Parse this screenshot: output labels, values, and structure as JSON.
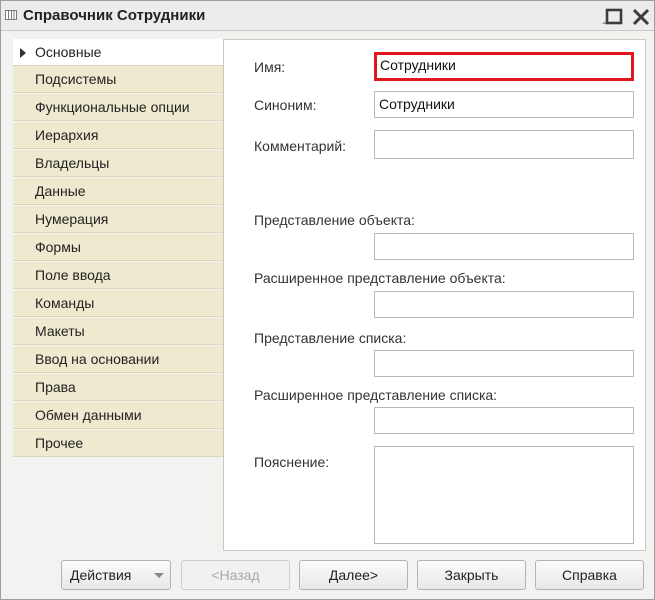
{
  "window": {
    "title": "Справочник Сотрудники",
    "minimize": "_",
    "maximize": "□",
    "close": "✕"
  },
  "sidebar": {
    "items": [
      {
        "label": "Основные",
        "active": true
      },
      {
        "label": "Подсистемы"
      },
      {
        "label": "Функциональные опции"
      },
      {
        "label": "Иерархия"
      },
      {
        "label": "Владельцы"
      },
      {
        "label": "Данные"
      },
      {
        "label": "Нумерация"
      },
      {
        "label": "Формы"
      },
      {
        "label": "Поле ввода"
      },
      {
        "label": "Команды"
      },
      {
        "label": "Макеты"
      },
      {
        "label": "Ввод на основании"
      },
      {
        "label": "Права"
      },
      {
        "label": "Обмен данными"
      },
      {
        "label": "Прочее"
      }
    ]
  },
  "form": {
    "name_label": "Имя:",
    "name_value": "Сотрудники",
    "synonym_label": "Синоним:",
    "synonym_value": "Сотрудники",
    "comment_label": "Комментарий:",
    "comment_value": "",
    "object_presentation_label": "Представление объекта:",
    "object_presentation_value": "",
    "ext_object_presentation_label": "Расширенное представление объекта:",
    "ext_object_presentation_value": "",
    "list_presentation_label": "Представление списка:",
    "list_presentation_value": "",
    "ext_list_presentation_label": "Расширенное представление списка:",
    "ext_list_presentation_value": "",
    "explanation_label": "Пояснение:"
  },
  "buttons": {
    "actions": "Действия",
    "back": "<Назад",
    "next": "Далее>",
    "close": "Закрыть",
    "help": "Справка"
  },
  "colors": {
    "highlight": "#e0161e",
    "tab_bg": "#efe9cf"
  }
}
